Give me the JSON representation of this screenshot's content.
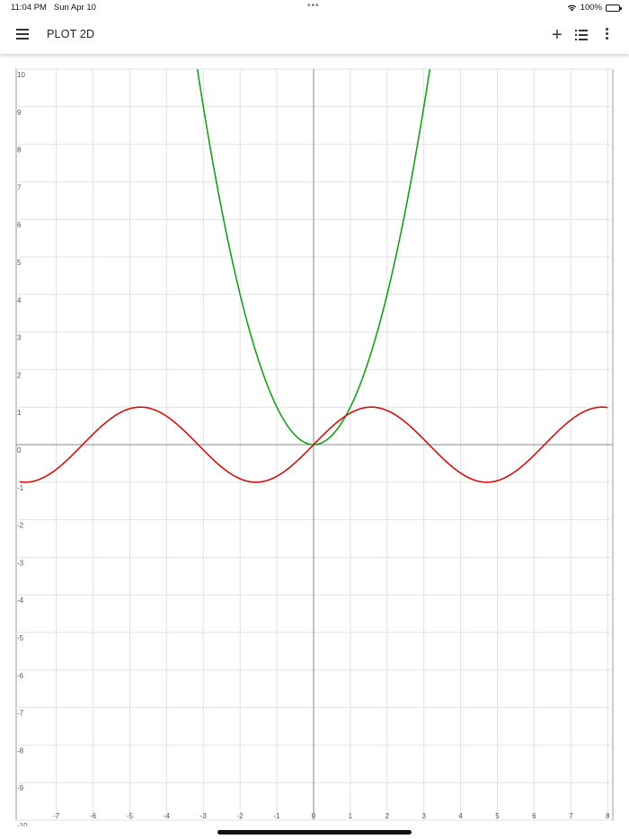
{
  "status": {
    "time": "11:04 PM",
    "date": "Sun Apr 10",
    "dots": "•••",
    "battery": "100%"
  },
  "appbar": {
    "menu_icon": "hamburger-menu-icon",
    "title": "PLOT 2D",
    "add_icon": "plus-icon",
    "list_icon": "list-icon",
    "more_icon": "more-vert-icon"
  },
  "chart_data": {
    "type": "line",
    "xlim": [
      -8,
      8
    ],
    "ylim": [
      -10,
      10
    ],
    "grid": true,
    "x_ticks": [
      -7,
      -6,
      -5,
      -4,
      -3,
      -2,
      -1,
      0,
      1,
      2,
      3,
      4,
      5,
      6,
      7,
      8
    ],
    "y_ticks": [
      -10,
      -9,
      -8,
      -7,
      -6,
      -5,
      -4,
      -3,
      -2,
      -1,
      0,
      1,
      2,
      3,
      4,
      5,
      6,
      7,
      8,
      9,
      10
    ],
    "series": [
      {
        "color": "#1a9e1a",
        "function": "x^2",
        "x_range": [
          -8,
          8
        ]
      },
      {
        "color": "#cc1111",
        "function": "sin(x)",
        "x_range": [
          -8,
          8
        ]
      }
    ]
  }
}
